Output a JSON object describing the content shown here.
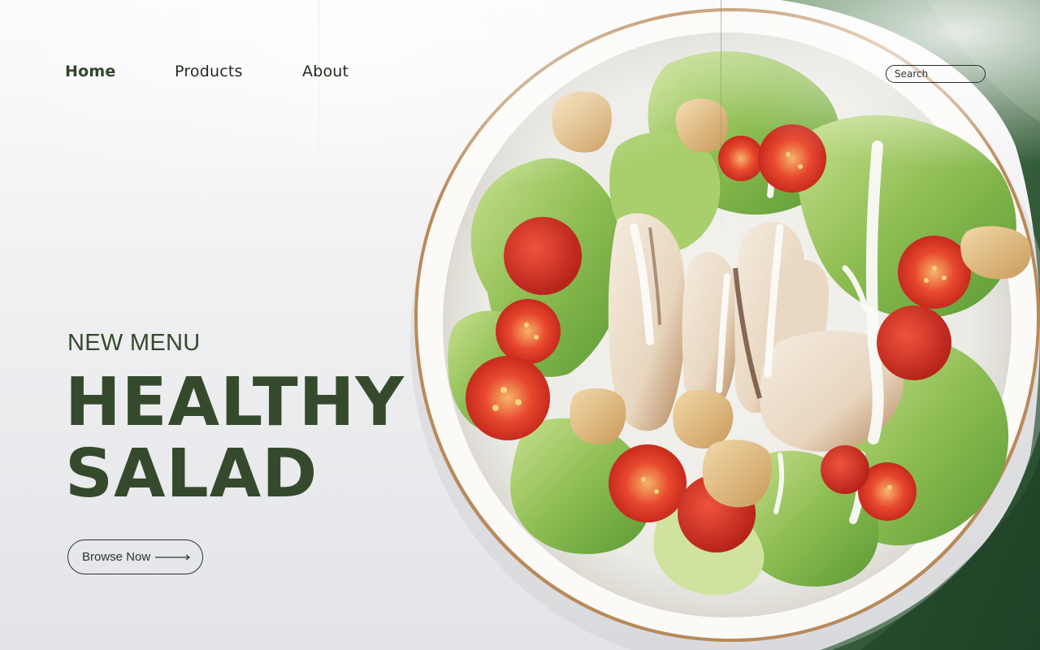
{
  "nav": {
    "items": [
      {
        "label": "Home",
        "active": true
      },
      {
        "label": "Products",
        "active": false
      },
      {
        "label": "About",
        "active": false
      }
    ]
  },
  "search": {
    "placeholder": "Search",
    "value": ""
  },
  "hero": {
    "eyebrow": "NEW MENU",
    "headline_line1": "HEALTHY",
    "headline_line2": "SALAD",
    "cta_label": "Browse Now"
  },
  "image": {
    "subject": "salad-bowl-image"
  },
  "colors": {
    "brand_green": "#354a2c",
    "text_dark": "#1f2a1c",
    "napkin_green": "#2f5a32"
  },
  "icons": {
    "cta_arrow": "long-arrow-right-icon"
  }
}
